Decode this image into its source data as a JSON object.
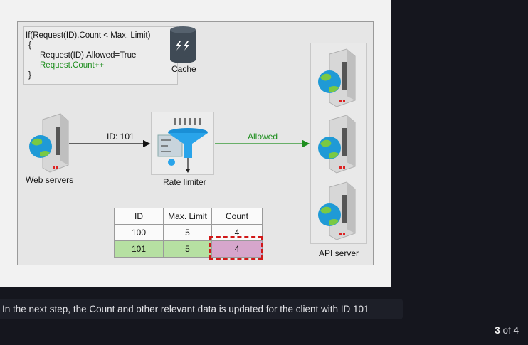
{
  "diagram": {
    "code": {
      "line1": "If(Request(ID).Count < Max. Limit)",
      "line2": "{",
      "line3": "Request(ID).Allowed=True",
      "line4": "Request.Count++",
      "line5": "}"
    },
    "cache_label": "Cache",
    "web_servers_label": "Web servers",
    "rate_limiter_label": "Rate limiter",
    "api_server_label": "API server",
    "request_label": "ID: 101",
    "allowed_label": "Allowed",
    "colors": {
      "allowed": "#1e8e1e",
      "highlight_row": "#b6e0a2",
      "highlight_count": "#d6a6cc",
      "dash": "#d01818"
    }
  },
  "table": {
    "headers": [
      "ID",
      "Max. Limit",
      "Count"
    ],
    "rows": [
      [
        "100",
        "5",
        "4"
      ],
      [
        "101",
        "5",
        "4"
      ]
    ]
  },
  "caption": "In the next step, the Count and other relevant data is updated for the client with ID 101",
  "pager": {
    "current": "3",
    "of_text": "of 4"
  }
}
